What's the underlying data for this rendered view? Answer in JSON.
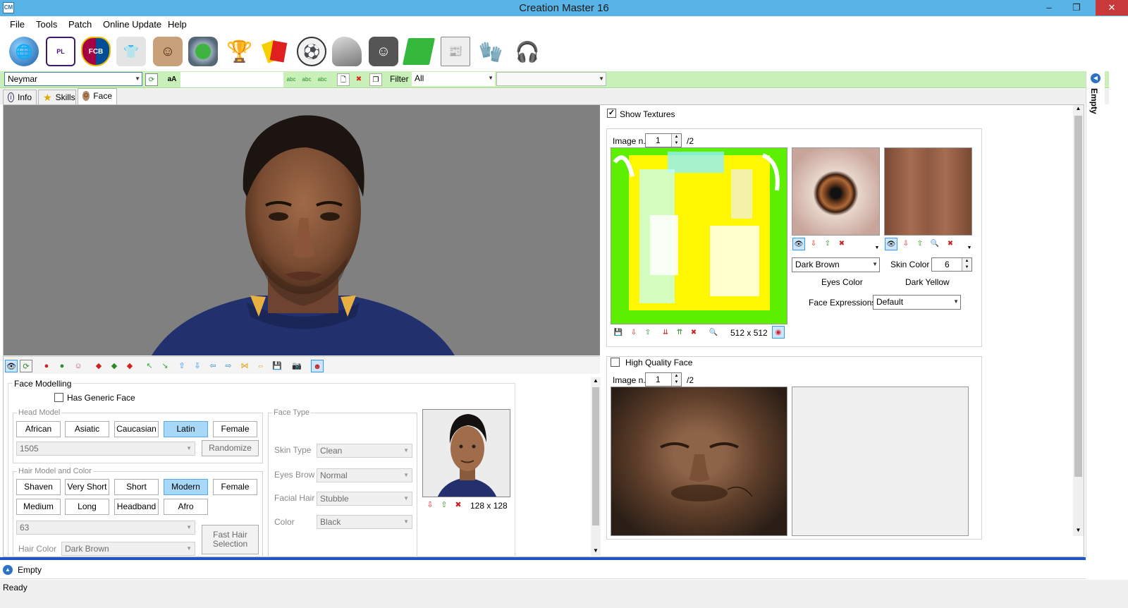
{
  "window": {
    "title": "Creation Master 16",
    "app_icon": "CM",
    "minimize": "–",
    "maximize": "❐",
    "close": "✕"
  },
  "menu": [
    "File",
    "Tools",
    "Patch",
    "Online Update",
    "Help"
  ],
  "toolbar_icons": [
    "globe-icon",
    "premier-league-icon",
    "fc-barcelona-crest-icon",
    "jersey-icon",
    "player-icon",
    "stadium-icon",
    "world-cup-trophy-icon",
    "referee-cards-icon",
    "football-icon",
    "boots-icon",
    "manager-icon",
    "pitch-icon",
    "newspaper-icon",
    "goalkeeper-gloves-icon",
    "headphones-icon"
  ],
  "search": {
    "player": "Neymar",
    "case_label": "aA",
    "filter_label": "Filter",
    "filter_value": "All",
    "filter2_value": ""
  },
  "tabs": [
    {
      "label": "Info"
    },
    {
      "label": "Skills"
    },
    {
      "label": "Face"
    }
  ],
  "face_modelling": {
    "title": "Face Modelling",
    "has_generic_face": "Has Generic Face",
    "head_model": {
      "title": "Head Model",
      "buttons": [
        "African",
        "Asiatic",
        "Caucasian",
        "Latin",
        "Female"
      ],
      "selected": "Latin",
      "id": "1505",
      "randomize": "Randomize"
    },
    "hair": {
      "title": "Hair Model and Color",
      "row1": [
        "Shaven",
        "Very Short",
        "Short",
        "Modern",
        "Female"
      ],
      "row2": [
        "Medium",
        "Long",
        "Headband",
        "Afro"
      ],
      "selected": "Modern",
      "id": "63",
      "fast_selection": "Fast Hair Selection",
      "color_label": "Hair Color",
      "color_value": "Dark Brown"
    },
    "face_type": {
      "title": "Face Type",
      "skin_type_label": "Skin Type",
      "skin_type": "Clean",
      "eyes_brow_label": "Eyes Brow",
      "eyes_brow": "Normal",
      "facial_hair_label": "Facial Hair",
      "facial_hair": "Stubble",
      "color_label": "Color",
      "color": "Black"
    },
    "photo_size": "128 x 128"
  },
  "textures": {
    "show_textures": "Show Textures",
    "image_label": "Image n.",
    "image_n": "1",
    "image_total": "/2",
    "size": "512 x 512",
    "eyes_color_value": "Dark Brown",
    "eyes_color_label": "Eyes Color",
    "skin_color_label": "Skin Color",
    "skin_color_value": "6",
    "skin_color_name": "Dark Yellow",
    "face_expressions_label": "Face Expressions",
    "face_expressions_value": "Default"
  },
  "hq_face": {
    "label": "High Quality Face",
    "image_label": "Image n.",
    "image_n": "1",
    "image_total": "/2"
  },
  "right_dock": {
    "label": "Empty"
  },
  "bottom_panel": {
    "label": "Empty"
  },
  "status": {
    "text": "Ready"
  }
}
